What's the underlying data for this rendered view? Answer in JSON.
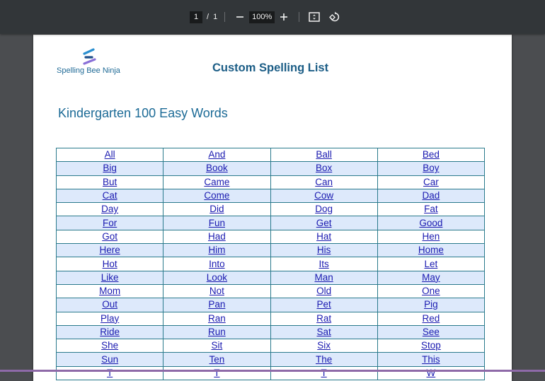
{
  "toolbar": {
    "page_current": "1",
    "page_separator": "/",
    "page_total": "1",
    "zoom_out_icon": "minus-icon",
    "zoom_level": "100%",
    "zoom_in_icon": "plus-icon",
    "fit_page_icon": "fit-to-page-icon",
    "rotate_icon": "rotate-icon"
  },
  "document": {
    "logo_text": "Spelling Bee Ninja",
    "title": "Custom Spelling List",
    "subtitle": "Kindergarten 100 Easy Words",
    "words": [
      [
        "All",
        "And",
        "Ball",
        "Bed"
      ],
      [
        "Big",
        "Book",
        "Box",
        "Boy"
      ],
      [
        "But",
        "Came",
        "Can",
        "Car"
      ],
      [
        "Cat",
        "Come",
        "Cow",
        "Dad"
      ],
      [
        "Day",
        "Did",
        "Dog",
        "Fat"
      ],
      [
        "For",
        "Fun",
        "Get",
        "Good"
      ],
      [
        "Got",
        "Had",
        "Hat",
        "Hen"
      ],
      [
        "Here",
        "Him",
        "His",
        "Home"
      ],
      [
        "Hot",
        "Into",
        "Its",
        "Let"
      ],
      [
        "Like",
        "Look",
        "Man",
        "May"
      ],
      [
        "Mom",
        "Not",
        "Old",
        "One"
      ],
      [
        "Out",
        "Pan",
        "Pet",
        "Pig"
      ],
      [
        "Play",
        "Ran",
        "Rat",
        "Red"
      ],
      [
        "Ride",
        "Run",
        "Sat",
        "See"
      ],
      [
        "She",
        "Sit",
        "Six",
        "Stop"
      ],
      [
        "Sun",
        "Ten",
        "The",
        "This"
      ],
      [
        "T",
        "T",
        "T",
        "W"
      ]
    ]
  },
  "colors": {
    "toolbar_bg": "#323639",
    "viewer_bg": "#4b4d50",
    "title_color": "#1b5d86",
    "link_color": "#1a1ab0",
    "row_alt_bg": "#dde9fb",
    "table_border": "#2a7a8c"
  }
}
